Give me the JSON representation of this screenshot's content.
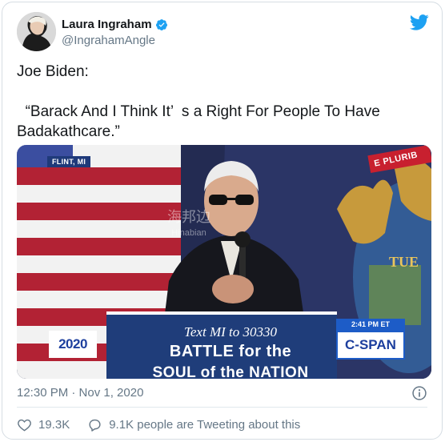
{
  "tweet": {
    "author": {
      "display_name": "Laura Ingraham",
      "handle": "@IngrahamAngle",
      "verified": true
    },
    "text": "Joe Biden:\n\n  “Barack And I Think It’  s a Right For People To Have Badakathcare.”",
    "timestamp": "12:30 PM · Nov 1, 2020",
    "likes": "19.3K",
    "replies_text": "9.1K people are Tweeting about this"
  },
  "media": {
    "location_label": "FLINT, MI",
    "podium_line1": "Text MI to 30330",
    "podium_line2": "BATTLE for the",
    "podium_line3": "SOUL of the NATION",
    "network_logo": "C-SPAN",
    "network_time": "2:41 PM ET",
    "campaign_logo": "2020",
    "watermark_cn": "海邦边",
    "watermark_en": "Hinabian",
    "seal_text": "TUE",
    "motto_text": "E PLURIB"
  },
  "icons": {
    "verified": "verified-badge-icon",
    "brand": "twitter-bird-icon",
    "info": "info-icon",
    "like": "heart-icon",
    "reply": "speech-bubble-icon"
  },
  "colors": {
    "brand_blue": "#1da1f2",
    "muted_text": "#657786",
    "body_text": "#14171a"
  }
}
